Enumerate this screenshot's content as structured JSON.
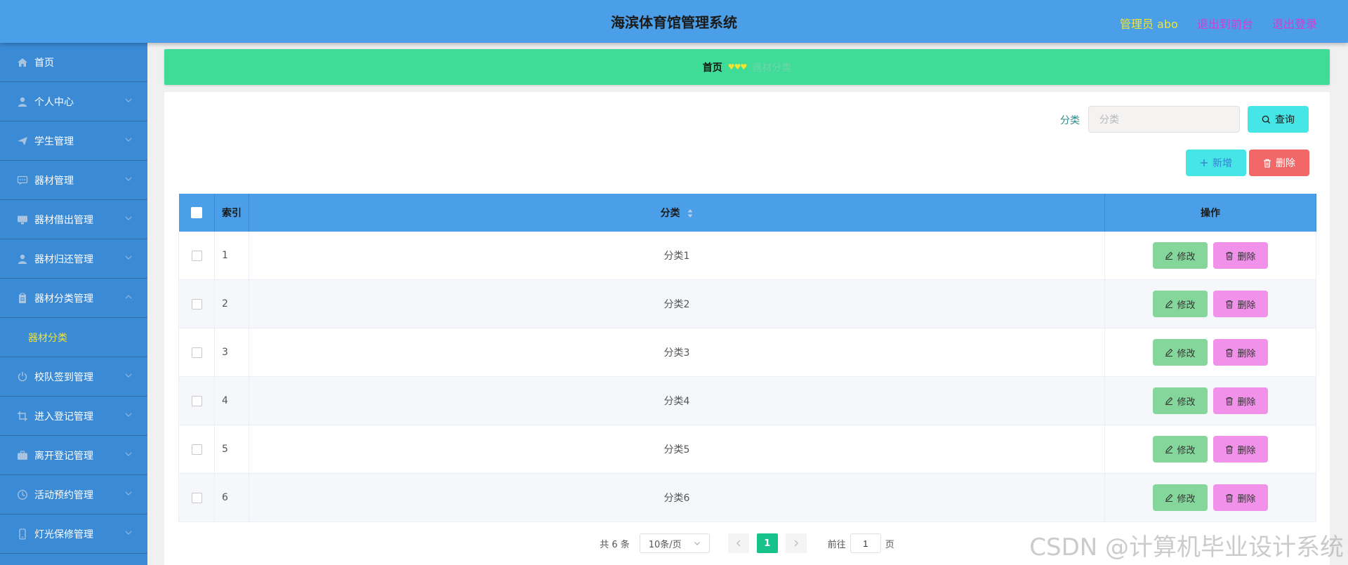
{
  "header": {
    "title": "海滨体育馆管理系统",
    "user_label": "管理员 abo",
    "to_front_label": "退出到前台",
    "logout_label": "退出登录",
    "user_color": "#f2e531",
    "link_color": "#d63ad6"
  },
  "sidebar": {
    "items": [
      {
        "label": "首页",
        "icon": "home-icon"
      },
      {
        "label": "个人中心",
        "icon": "user-icon"
      },
      {
        "label": "学生管理",
        "icon": "send-icon"
      },
      {
        "label": "器材管理",
        "icon": "chat-icon"
      },
      {
        "label": "器材借出管理",
        "icon": "monitor-icon"
      },
      {
        "label": "器材归还管理",
        "icon": "user-icon"
      },
      {
        "label": "器材分类管理",
        "icon": "clipboard-icon"
      },
      {
        "label": "校队签到管理",
        "icon": "power-icon"
      },
      {
        "label": "进入登记管理",
        "icon": "crop-icon"
      },
      {
        "label": "离开登记管理",
        "icon": "briefcase-icon"
      },
      {
        "label": "活动预约管理",
        "icon": "clock-icon"
      },
      {
        "label": "灯光保修管理",
        "icon": "phone-icon"
      }
    ],
    "sub_item": "器材分类"
  },
  "breadcrumb": {
    "home": "首页",
    "separator": "♥♥♥",
    "current": "器材分类"
  },
  "search": {
    "label": "分类",
    "placeholder": "分类",
    "query_label": "查询"
  },
  "actions": {
    "add_label": "新增",
    "delete_label": "删除"
  },
  "table": {
    "headers": {
      "index": "索引",
      "category": "分类",
      "ops": "操作"
    },
    "rows": [
      {
        "index": "1",
        "category": "分类1"
      },
      {
        "index": "2",
        "category": "分类2"
      },
      {
        "index": "3",
        "category": "分类3"
      },
      {
        "index": "4",
        "category": "分类4"
      },
      {
        "index": "5",
        "category": "分类5"
      },
      {
        "index": "6",
        "category": "分类6"
      }
    ],
    "edit_label": "修改",
    "row_delete_label": "删除"
  },
  "pagination": {
    "total": "共 6 条",
    "page_size": "10条/页",
    "current_page": "1",
    "goto_prefix": "前往",
    "goto_value": "1",
    "goto_suffix": "页"
  },
  "watermark": "CSDN @计算机毕业设计系统"
}
